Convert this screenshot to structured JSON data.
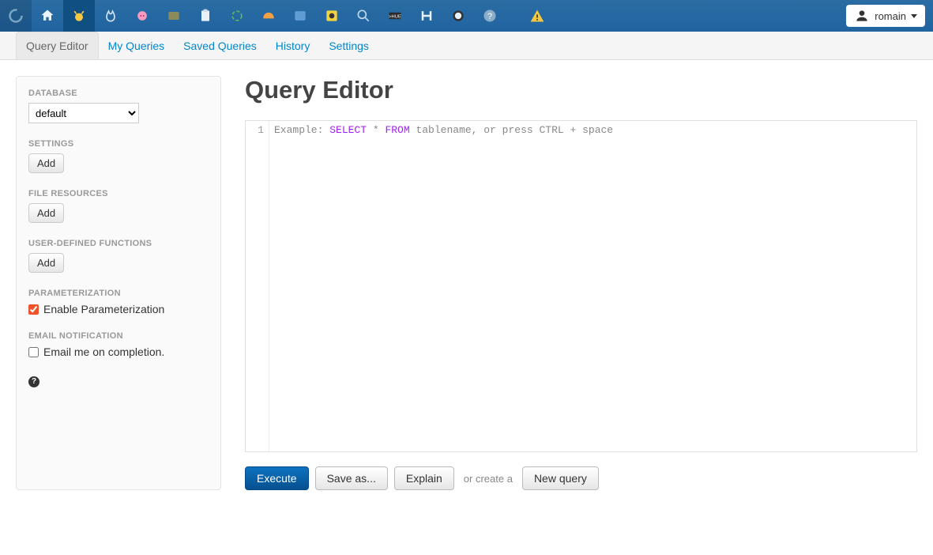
{
  "user": {
    "name": "romain"
  },
  "subnav": {
    "items": [
      {
        "label": "Query Editor",
        "active": true
      },
      {
        "label": "My Queries"
      },
      {
        "label": "Saved Queries"
      },
      {
        "label": "History"
      },
      {
        "label": "Settings"
      }
    ]
  },
  "sidebar": {
    "database_label": "DATABASE",
    "database_value": "default",
    "settings_label": "SETTINGS",
    "settings_add": "Add",
    "fileres_label": "FILE RESOURCES",
    "fileres_add": "Add",
    "udf_label": "USER-DEFINED FUNCTIONS",
    "udf_add": "Add",
    "param_label": "PARAMETERIZATION",
    "param_chk_label": "Enable Parameterization",
    "param_chk_checked": true,
    "email_label": "EMAIL NOTIFICATION",
    "email_chk_label": "Email me on completion.",
    "email_chk_checked": false
  },
  "main": {
    "title": "Query Editor",
    "editor": {
      "line_number": "1",
      "placeholder_pre": "Example: ",
      "kw1": "SELECT",
      "mid": " * ",
      "kw2": "FROM",
      "placeholder_post": " tablename, or press CTRL + space"
    },
    "actions": {
      "execute": "Execute",
      "save_as": "Save as...",
      "explain": "Explain",
      "or_text": "or create a",
      "new_query": "New query"
    }
  },
  "topbar_icons": [
    "hue-logo",
    "home-icon",
    "beeswax-icon",
    "impala-icon",
    "pig-icon",
    "sqoop-icon",
    "clipboard-icon",
    "oozie-icon",
    "hardhat-icon",
    "folder-icon",
    "disc-icon",
    "search-icon",
    "hue-badge-icon",
    "hbase-icon",
    "zookeeper-icon",
    "help-icon"
  ]
}
